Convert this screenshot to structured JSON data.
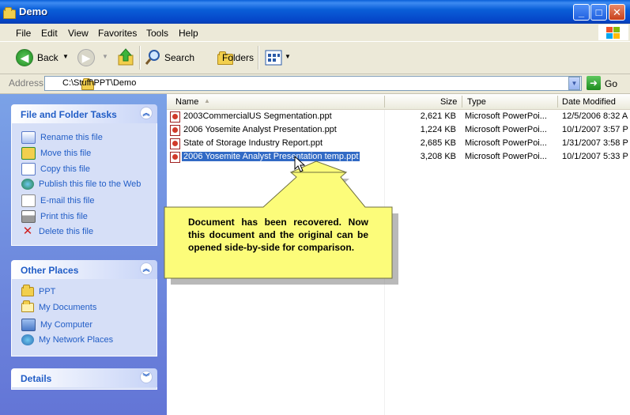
{
  "window": {
    "title": "Demo"
  },
  "menu": [
    "File",
    "Edit",
    "View",
    "Favorites",
    "Tools",
    "Help"
  ],
  "toolbar": {
    "back": "Back",
    "search": "Search",
    "folders": "Folders"
  },
  "address": {
    "label": "Address",
    "path": "C:\\Stuff\\PPT\\Demo",
    "go": "Go"
  },
  "tasks": {
    "title": "File and Folder Tasks",
    "items": [
      "Rename this file",
      "Move this file",
      "Copy this file",
      "Publish this file to the Web",
      "E-mail this file",
      "Print this file",
      "Delete this file"
    ]
  },
  "places": {
    "title": "Other Places",
    "items": [
      "PPT",
      "My Documents",
      "My Computer",
      "My Network Places"
    ]
  },
  "details": {
    "title": "Details"
  },
  "columns": {
    "name": "Name",
    "size": "Size",
    "type": "Type",
    "date": "Date Modified"
  },
  "files": [
    {
      "name": "2003CommercialUS Segmentation.ppt",
      "size": "2,621 KB",
      "type": "Microsoft PowerPoi...",
      "date": "12/5/2006 8:32 A"
    },
    {
      "name": "2006 Yosemite Analyst Presentation.ppt",
      "size": "1,224 KB",
      "type": "Microsoft PowerPoi...",
      "date": "10/1/2007 3:57 P"
    },
    {
      "name": "State of Storage Industry Report.ppt",
      "size": "2,685 KB",
      "type": "Microsoft PowerPoi...",
      "date": "1/31/2007 3:58 P"
    },
    {
      "name": "2006 Yosemite Analyst Presentation temp.ppt",
      "size": "3,208 KB",
      "type": "Microsoft PowerPoi...",
      "date": "10/1/2007 5:33 P"
    }
  ],
  "callout": {
    "text": "Document has been recovered. Now this document and the original can be opened side-by-side for comparison."
  }
}
